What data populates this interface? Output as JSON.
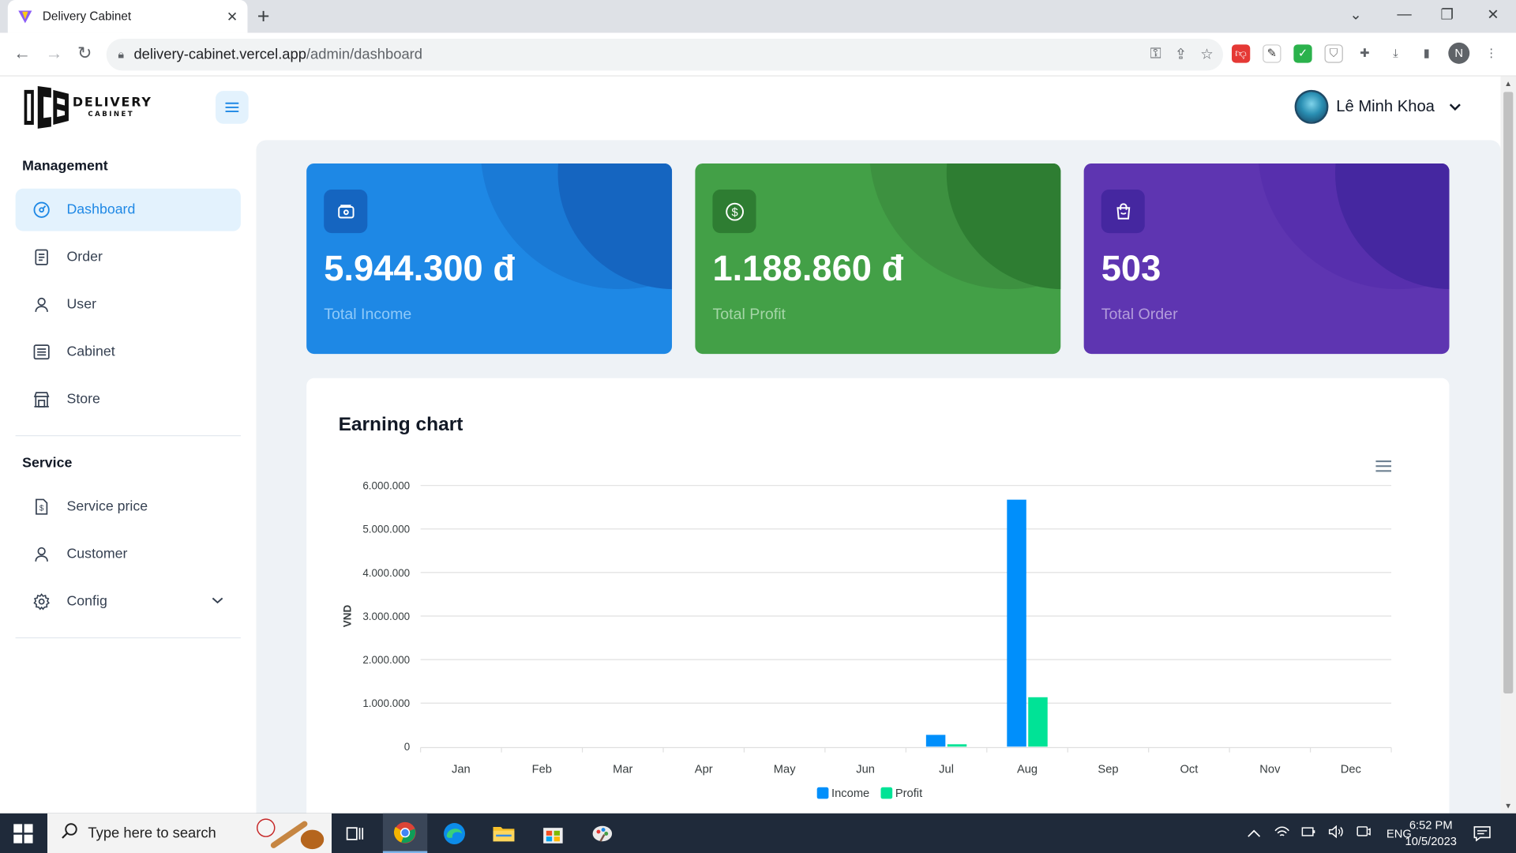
{
  "browser": {
    "tab_title": "Delivery Cabinet",
    "url_domain": "delivery-cabinet.vercel.app",
    "url_path": "/admin/dashboard",
    "profile_initial": "N"
  },
  "logo": {
    "line1": "DELIVERY",
    "line2": "CABINET"
  },
  "user": {
    "name": "Lê Minh Khoa"
  },
  "sidebar": {
    "management_title": "Management",
    "management_items": [
      {
        "label": "Dashboard",
        "icon": "dashboard-icon",
        "active": true
      },
      {
        "label": "Order",
        "icon": "receipt-icon"
      },
      {
        "label": "User",
        "icon": "user-icon"
      },
      {
        "label": "Cabinet",
        "icon": "cabinet-icon"
      },
      {
        "label": "Store",
        "icon": "store-icon"
      }
    ],
    "service_title": "Service",
    "service_items": [
      {
        "label": "Service price",
        "icon": "price-file-icon"
      },
      {
        "label": "Customer",
        "icon": "customer-icon"
      },
      {
        "label": "Config",
        "icon": "settings-icon"
      }
    ]
  },
  "cards": [
    {
      "value": "5.944.300 đ",
      "label": "Total Income",
      "color": "#1e88e5"
    },
    {
      "value": "1.188.860 đ",
      "label": "Total Profit",
      "color": "#43a047"
    },
    {
      "value": "503",
      "label": "Total Order",
      "color": "#5e35b1"
    }
  ],
  "chart": {
    "title": "Earning chart"
  },
  "chart_data": {
    "type": "bar",
    "title": "Earning chart",
    "xlabel": "",
    "ylabel": "VND",
    "categories": [
      "Jan",
      "Feb",
      "Mar",
      "Apr",
      "May",
      "Jun",
      "Jul",
      "Aug",
      "Sep",
      "Oct",
      "Nov",
      "Dec"
    ],
    "series": [
      {
        "name": "Income",
        "color": "#008ffb",
        "values": [
          0,
          0,
          0,
          0,
          0,
          0,
          270000,
          5674300,
          0,
          0,
          0,
          0
        ]
      },
      {
        "name": "Profit",
        "color": "#00e396",
        "values": [
          0,
          0,
          0,
          0,
          0,
          0,
          54000,
          1134860,
          0,
          0,
          0,
          0
        ]
      }
    ],
    "ylim": [
      0,
      6000000
    ],
    "yticks": [
      "0",
      "1.000.000",
      "2.000.000",
      "3.000.000",
      "4.000.000",
      "5.000.000",
      "6.000.000"
    ],
    "grid": true,
    "legend_position": "bottom-center"
  },
  "taskbar": {
    "search_placeholder": "Type here to search",
    "language": "ENG",
    "time": "6:52 PM",
    "date": "10/5/2023"
  }
}
